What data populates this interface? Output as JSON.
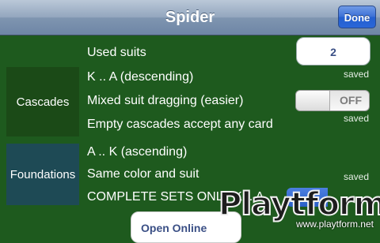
{
  "navbar": {
    "title": "Spider",
    "done_label": "Done"
  },
  "cascades": {
    "section_label": "Cascades",
    "used_suits": {
      "label": "Used suits",
      "value": "2",
      "status": "saved"
    },
    "order_label": "K .. A (descending)",
    "mixed_suit": {
      "label": "Mixed suit dragging (easier)",
      "toggle_text": "OFF",
      "status": "saved"
    },
    "empty_label": "Empty cascades accept any card"
  },
  "foundations": {
    "section_label": "Foundations",
    "order_label": "A .. K (ascending)",
    "same_color_label": "Same color and suit",
    "same_color_status": "saved",
    "complete_sets_label": "COMPLETE SETS ONLY K .. A"
  },
  "open_online_label": "Open Online",
  "watermark": {
    "text": "Playtform",
    "url": "www.playtform.net"
  },
  "colors": {
    "background": "#1e5a1e",
    "accent": "#2a66d8"
  }
}
